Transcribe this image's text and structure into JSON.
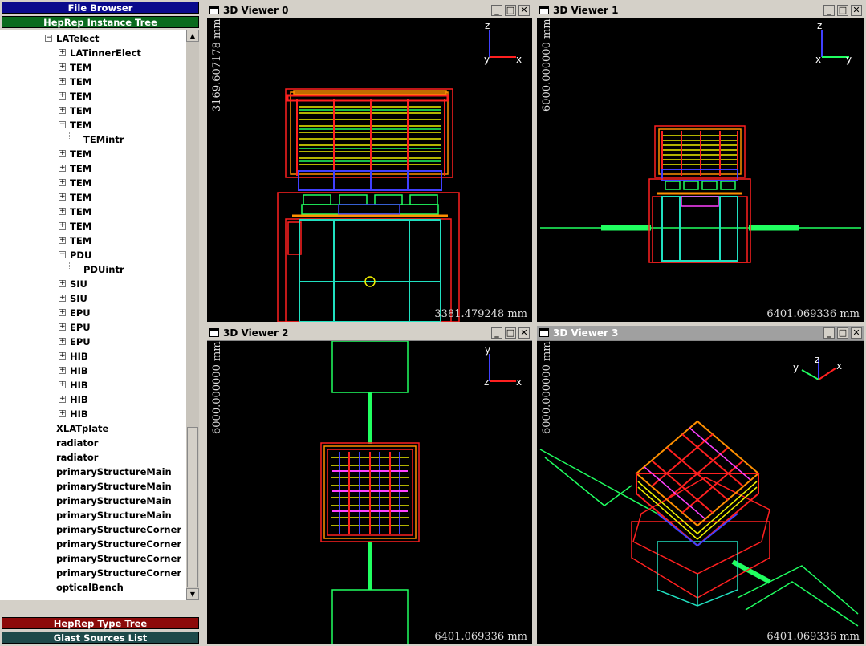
{
  "left_panel": {
    "file_browser": "File Browser",
    "instance_tree": "HepRep Instance Tree",
    "type_tree": "HepRep Type Tree",
    "sources_list": "Glast Sources List",
    "colors": {
      "file_browser": "#0a0a8c",
      "instance_tree": "#0a6b1e",
      "type_tree": "#8c0a0a",
      "sources_list": "#1e4a4a"
    }
  },
  "tree": [
    {
      "label": "LATelect",
      "expander": "−"
    },
    {
      "label": "LATinnerElect",
      "expander": "+"
    },
    {
      "label": "TEM",
      "expander": "+"
    },
    {
      "label": "TEM",
      "expander": "+"
    },
    {
      "label": "TEM",
      "expander": "+"
    },
    {
      "label": "TEM",
      "expander": "+"
    },
    {
      "label": "TEM",
      "expander": "−"
    },
    {
      "label": "TEMintr",
      "expander": ""
    },
    {
      "label": "TEM",
      "expander": "+"
    },
    {
      "label": "TEM",
      "expander": "+"
    },
    {
      "label": "TEM",
      "expander": "+"
    },
    {
      "label": "TEM",
      "expander": "+"
    },
    {
      "label": "TEM",
      "expander": "+"
    },
    {
      "label": "TEM",
      "expander": "+"
    },
    {
      "label": "TEM",
      "expander": "+"
    },
    {
      "label": "PDU",
      "expander": "−"
    },
    {
      "label": "PDUintr",
      "expander": ""
    },
    {
      "label": "SIU",
      "expander": "+"
    },
    {
      "label": "SIU",
      "expander": "+"
    },
    {
      "label": "EPU",
      "expander": "+"
    },
    {
      "label": "EPU",
      "expander": "+"
    },
    {
      "label": "EPU",
      "expander": "+"
    },
    {
      "label": "HIB",
      "expander": "+"
    },
    {
      "label": "HIB",
      "expander": "+"
    },
    {
      "label": "HIB",
      "expander": "+"
    },
    {
      "label": "HIB",
      "expander": "+"
    },
    {
      "label": "HIB",
      "expander": "+"
    },
    {
      "label": "XLATplate",
      "expander": ""
    },
    {
      "label": "radiator",
      "expander": ""
    },
    {
      "label": "radiator",
      "expander": ""
    },
    {
      "label": "primaryStructureMain",
      "expander": ""
    },
    {
      "label": "primaryStructureMain",
      "expander": ""
    },
    {
      "label": "primaryStructureMain",
      "expander": ""
    },
    {
      "label": "primaryStructureMain",
      "expander": ""
    },
    {
      "label": "primaryStructureCorner",
      "expander": ""
    },
    {
      "label": "primaryStructureCorner",
      "expander": ""
    },
    {
      "label": "primaryStructureCorner",
      "expander": ""
    },
    {
      "label": "primaryStructureCorner",
      "expander": ""
    },
    {
      "label": "opticalBench",
      "expander": ""
    }
  ],
  "viewers": [
    {
      "title": "3D Viewer 0",
      "hsize": "3381.479248 mm",
      "vsize": "3169.607178 mm",
      "axes": {
        "up": "z",
        "right": "x",
        "origin": "y"
      }
    },
    {
      "title": "3D Viewer 1",
      "hsize": "6401.069336 mm",
      "vsize": "6000.000000 mm",
      "axes": {
        "up": "z",
        "right": "y",
        "origin": "x"
      }
    },
    {
      "title": "3D Viewer 2",
      "hsize": "6401.069336 mm",
      "vsize": "6000.000000 mm",
      "axes": {
        "up": "y",
        "right": "x",
        "origin": "z"
      }
    },
    {
      "title": "3D Viewer 3",
      "hsize": "6401.069336 mm",
      "vsize": "6000.000000 mm",
      "axes": {
        "up": "z",
        "left": "y",
        "right": "x"
      }
    }
  ],
  "window_buttons": {
    "minimize": "_",
    "maximize": "□",
    "close": "✕"
  },
  "colors": {
    "canvas": "#000000",
    "red": "#ff2020",
    "yellow": "#f0f000",
    "green": "#20ff60",
    "cyan": "#20e0c0",
    "blue": "#4040ff",
    "orange": "#ff9000",
    "magenta": "#ff40ff"
  }
}
